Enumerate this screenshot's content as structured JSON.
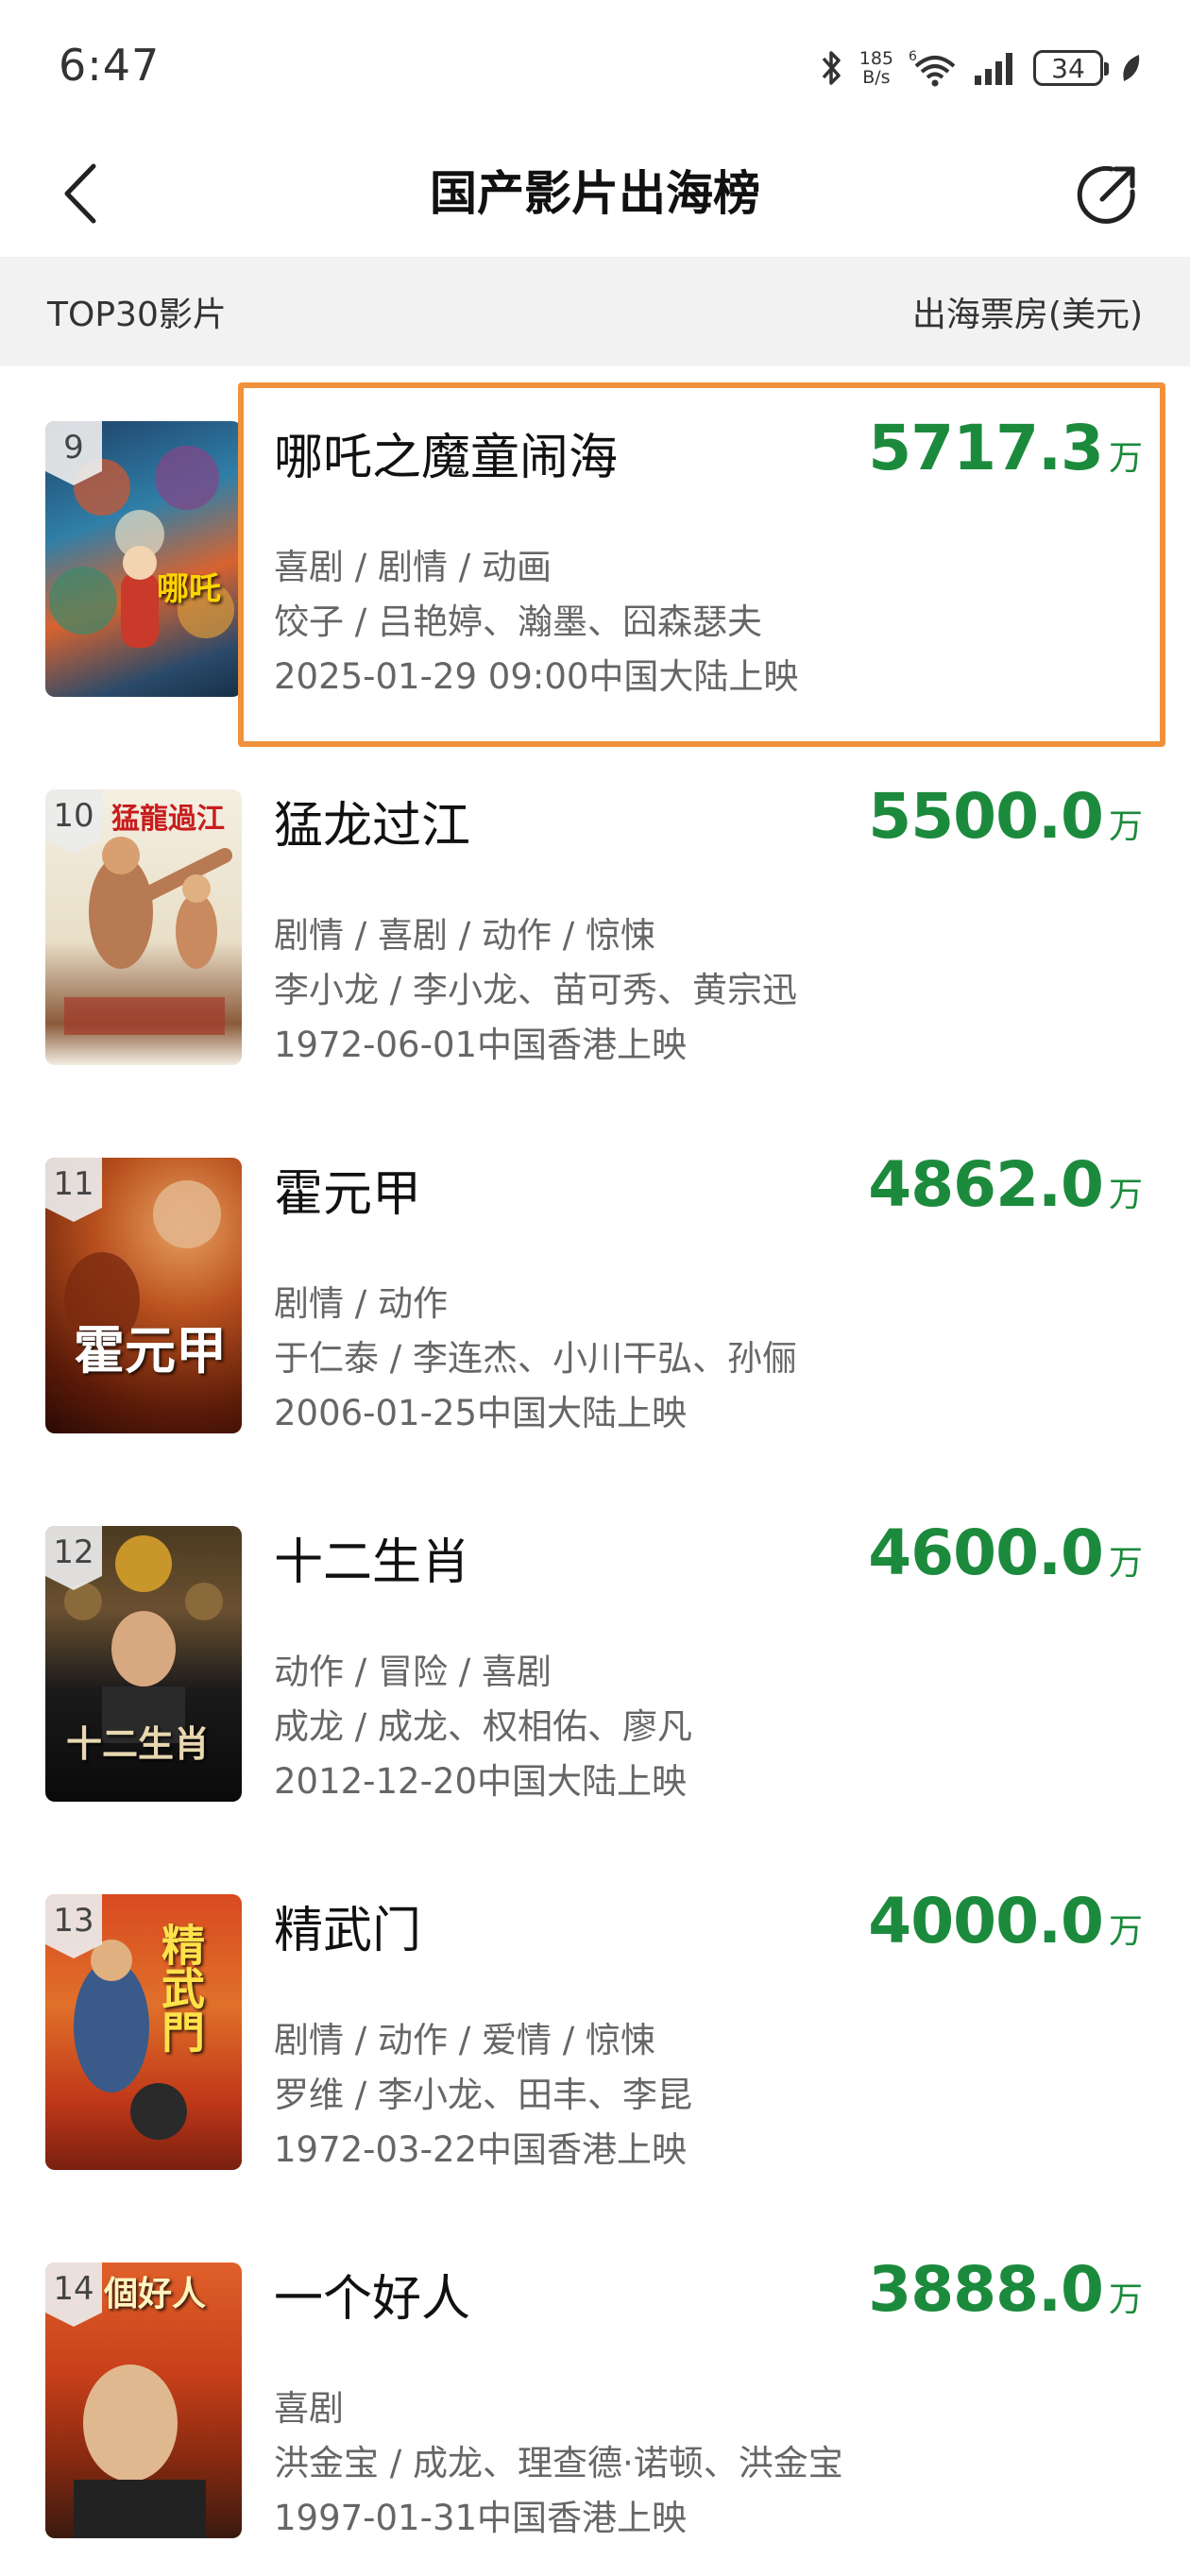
{
  "status": {
    "time": "6:47",
    "net_speed_value": "185",
    "net_speed_unit": "B/s",
    "signal_label": "6",
    "battery": "34"
  },
  "header": {
    "title": "国产影片出海榜"
  },
  "section": {
    "left_label": "TOP30影片",
    "right_label": "出海票房(美元)"
  },
  "colors": {
    "box_office": "#1c8a3c",
    "highlight_border": "#f0913b",
    "section_bg": "#f2f2f2"
  },
  "movies": [
    {
      "rank": "9",
      "name": "哪吒之魔童闹海",
      "box": "5717.3",
      "unit": "万",
      "genres": "喜剧 / 剧情 / 动画",
      "cast": "饺子 / 吕艳婷、瀚墨、囧森瑟夫",
      "release": "2025-01-29 09:00中国大陆上映",
      "poster_text": "哪吒",
      "highlighted": true
    },
    {
      "rank": "10",
      "name": "猛龙过江",
      "box": "5500.0",
      "unit": "万",
      "genres": "剧情 / 喜剧 / 动作 / 惊悚",
      "cast": "李小龙 / 李小龙、苗可秀、黄宗迅",
      "release": "1972-06-01中国香港上映",
      "poster_text": "猛龍過江",
      "highlighted": false
    },
    {
      "rank": "11",
      "name": "霍元甲",
      "box": "4862.0",
      "unit": "万",
      "genres": "剧情 / 动作",
      "cast": "于仁泰 / 李连杰、小川干弘、孙俪",
      "release": "2006-01-25中国大陆上映",
      "poster_text": "霍元甲",
      "highlighted": false
    },
    {
      "rank": "12",
      "name": "十二生肖",
      "box": "4600.0",
      "unit": "万",
      "genres": "动作 / 冒险 / 喜剧",
      "cast": "成龙 / 成龙、权相佑、廖凡",
      "release": "2012-12-20中国大陆上映",
      "poster_text": "十二生肖",
      "highlighted": false
    },
    {
      "rank": "13",
      "name": "精武门",
      "box": "4000.0",
      "unit": "万",
      "genres": "剧情 / 动作 / 爱情 / 惊悚",
      "cast": "罗维 / 李小龙、田丰、李昆",
      "release": "1972-03-22中国香港上映",
      "poster_text": "精武門",
      "highlighted": false
    },
    {
      "rank": "14",
      "name": "一个好人",
      "box": "3888.0",
      "unit": "万",
      "genres": "喜剧",
      "cast": "洪金宝 / 成龙、理查德·诺顿、洪金宝",
      "release": "1997-01-31中国香港上映",
      "poster_text": "個好人",
      "highlighted": false
    }
  ]
}
